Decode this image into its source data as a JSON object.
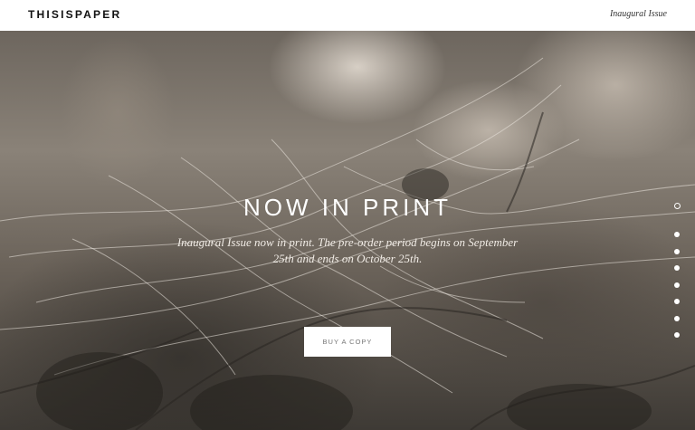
{
  "header": {
    "logo": "THISISPAPER",
    "issue_link": "Inaugural Issue"
  },
  "hero": {
    "title": "NOW IN PRINT",
    "subtitle": "Inaugural Issue now in print. The pre-order period begins on September 25th and ends on October 25th.",
    "button_label": "BUY A COPY"
  },
  "pagination": {
    "total": 8,
    "active_index": 0
  },
  "colors": {
    "text_dark": "#111111",
    "hero_text": "#ffffff",
    "button_bg": "#ffffff",
    "button_text": "#777777"
  }
}
